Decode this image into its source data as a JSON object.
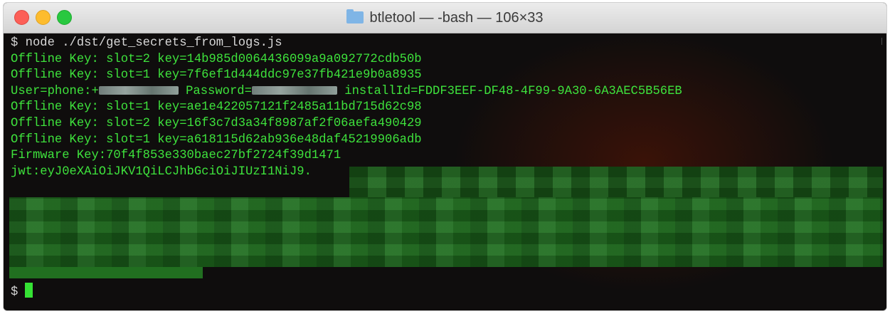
{
  "window": {
    "title": "btletool — -bash — 106×33"
  },
  "terminal": {
    "lines": [
      "$ node ./dst/get_secrets_from_logs.js",
      "Offline Key: slot=2 key=14b985d0064436099a9a092772cdb50b",
      "Offline Key: slot=1 key=7f6ef1d444ddc97e37fb421e9b0a8935",
      "User=phone:+",
      "Offline Key: slot=1 key=ae1e422057121f2485a11bd715d62c98",
      "Offline Key: slot=2 key=16f3c7d3a34f8987af2f06aefa490429",
      "Offline Key: slot=1 key=a618115d62ab936e48daf45219906adb",
      "Firmware Key:70f4f853e330baec27bf2724f39d1471",
      "jwt:eyJ0eXAiOiJKV1QiLCJhbGciOiJIUzI1NiJ9."
    ],
    "user_line_parts": {
      "password_label": " Password=",
      "install_label": " installId=FDDF3EEF-DF48-4F99-9A30-6A3AEC5B56EB"
    },
    "final_prompt": "$",
    "colors": {
      "text": "#3ee23c",
      "background": "#0f0d0d",
      "redaction_block": "#1f6d1e"
    }
  }
}
